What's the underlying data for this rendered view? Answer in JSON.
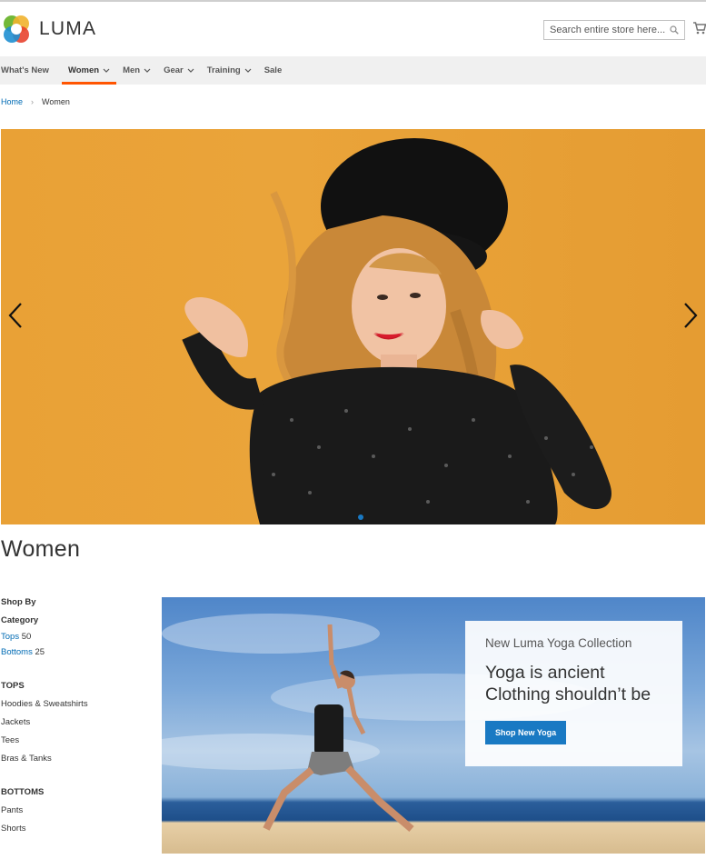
{
  "brand": {
    "name": "LUMA"
  },
  "search": {
    "placeholder": "Search entire store here..."
  },
  "nav": {
    "items": [
      {
        "label": "What's New",
        "dropdown": false,
        "active": false
      },
      {
        "label": "Women",
        "dropdown": true,
        "active": true
      },
      {
        "label": "Men",
        "dropdown": true,
        "active": false
      },
      {
        "label": "Gear",
        "dropdown": true,
        "active": false
      },
      {
        "label": "Training",
        "dropdown": true,
        "active": false
      },
      {
        "label": "Sale",
        "dropdown": false,
        "active": false
      }
    ]
  },
  "breadcrumbs": {
    "home": "Home",
    "separator": "›",
    "current": "Women"
  },
  "page": {
    "title": "Women"
  },
  "sidebar": {
    "shop_by": "Shop By",
    "category_heading": "Category",
    "categories": [
      {
        "label": "Tops",
        "count": "50"
      },
      {
        "label": "Bottoms",
        "count": "25"
      }
    ],
    "groups": [
      {
        "heading": "TOPS",
        "items": [
          "Hoodies & Sweatshirts",
          "Jackets",
          "Tees",
          "Bras & Tanks"
        ]
      },
      {
        "heading": "BOTTOMS",
        "items": [
          "Pants",
          "Shorts"
        ]
      }
    ]
  },
  "promo": {
    "subtitle": "New Luma Yoga Collection",
    "headline_line1": "Yoga is ancient",
    "headline_line2": "Clothing shouldn’t be",
    "button": "Shop New Yoga"
  },
  "colors": {
    "accent": "#1979c3",
    "nav_active": "#ff5501",
    "hero_bg": "#e9a136",
    "link": "#006bb4"
  }
}
